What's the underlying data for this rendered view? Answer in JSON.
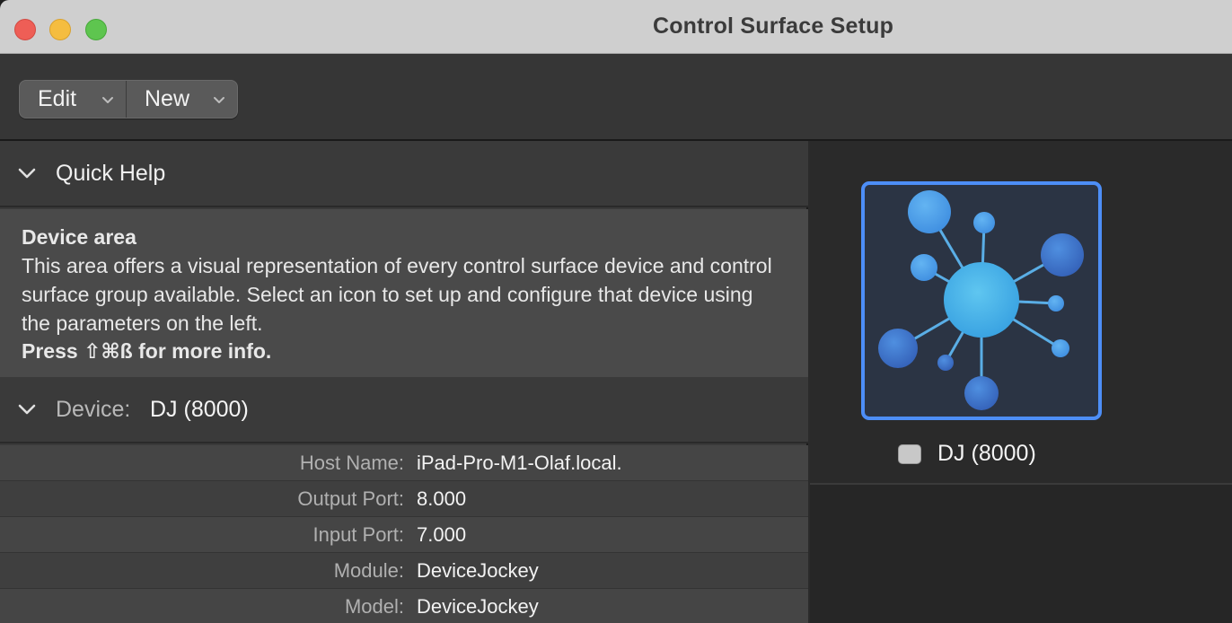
{
  "window": {
    "title": "Control Surface Setup"
  },
  "toolbar": {
    "edit_label": "Edit",
    "new_label": "New"
  },
  "quick_help": {
    "header": "Quick Help",
    "title": "Device area",
    "text": "This area offers a visual representation of every control surface device and control surface group available. Select an icon to set up and configure that device using the parameters on the left.",
    "press": "Press ⇧⌘ß for more info."
  },
  "device": {
    "label": "Device:",
    "value": "DJ (8000)",
    "params": [
      {
        "label": "Host Name:",
        "value": "iPad-Pro-M1-Olaf.local."
      },
      {
        "label": "Output Port:",
        "value": "8.000"
      },
      {
        "label": "Input Port:",
        "value": "7.000"
      },
      {
        "label": "Module:",
        "value": "DeviceJockey"
      },
      {
        "label": "Model:",
        "value": "DeviceJockey"
      }
    ]
  },
  "device_area": {
    "selected_device_name": "DJ (8000)",
    "icon": "network-hub-icon",
    "accent_color": "#4d8ef7"
  },
  "colors": {
    "traffic_close": "#ee5e56",
    "traffic_minimize": "#f5bd40",
    "traffic_zoom": "#5ec54f"
  }
}
